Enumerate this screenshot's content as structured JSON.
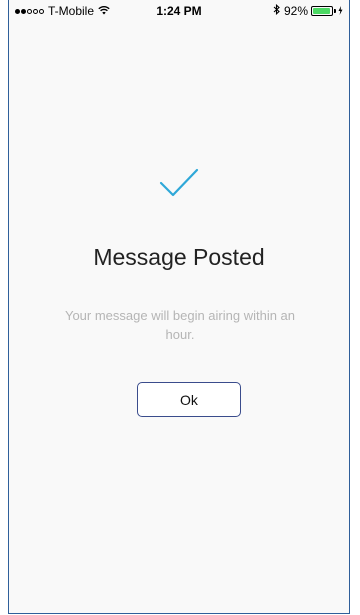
{
  "status_bar": {
    "carrier": "T-Mobile",
    "time": "1:24 PM",
    "battery": "92%",
    "battery_level": 0.92,
    "signal_bars_on": 2,
    "signal_bars_total": 5
  },
  "dialog": {
    "title": "Message Posted",
    "message": "Your message will begin airing within an hour.",
    "ok_label": "Ok"
  },
  "colors": {
    "accent": "#2fa8d8",
    "button_border": "#3a4c8c",
    "muted_text": "#b5b5b5",
    "battery_fill": "#4cd964"
  },
  "icons": {
    "check": "checkmark-icon",
    "wifi": "wifi-icon",
    "bluetooth": "bluetooth-icon",
    "battery": "battery-icon",
    "charging": "charging-icon"
  }
}
